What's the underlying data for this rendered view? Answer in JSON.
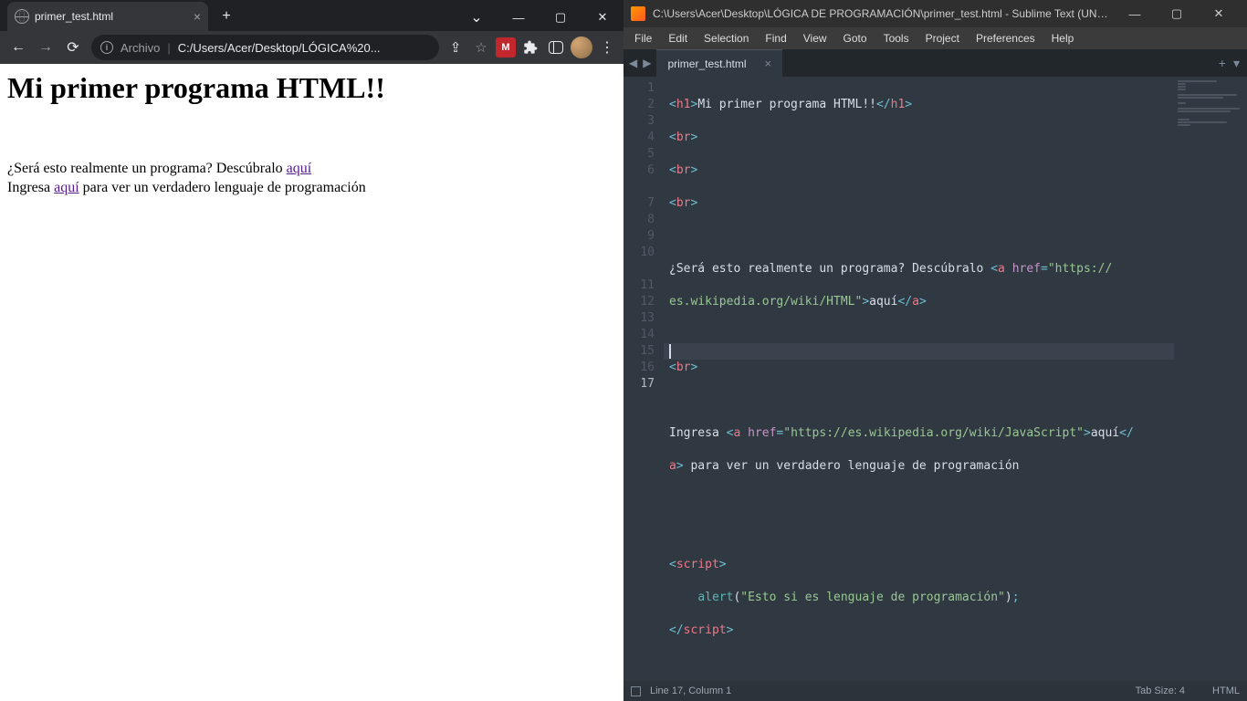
{
  "chrome": {
    "tab_title": "primer_test.html",
    "url_label": "Archivo",
    "url_path": "C:/Users/Acer/Desktop/LÓGICA%20...",
    "ext_red": "M",
    "page": {
      "h1": "Mi primer programa HTML!!",
      "line1_a": "¿Será esto realmente un programa? Descúbralo ",
      "line1_link": "aquí",
      "line2_a": "Ingresa ",
      "line2_link": "aquí",
      "line2_b": " para ver un verdadero lenguaje de programación"
    }
  },
  "sublime": {
    "title": "C:\\Users\\Acer\\Desktop\\LÓGICA DE PROGRAMACIÓN\\primer_test.html - Sublime Text (UNREGI...",
    "menu": [
      "File",
      "Edit",
      "Selection",
      "Find",
      "View",
      "Goto",
      "Tools",
      "Project",
      "Preferences",
      "Help"
    ],
    "tab": "primer_test.html",
    "lines": [
      "1",
      "2",
      "3",
      "4",
      "5",
      "6",
      "7",
      "8",
      "9",
      "10",
      "11",
      "12",
      "13",
      "14",
      "15",
      "16",
      "17"
    ],
    "code": {
      "h1_open": "h1",
      "h1_text": "Mi primer programa HTML!!",
      "h1_close": "h1",
      "br": "br",
      "l6a": "¿Será esto realmente un programa? Descúbralo ",
      "a": "a",
      "href": "href",
      "eq": "=",
      "url1": "\"https://",
      "url1b": "es.wikipedia.org/wiki/HTML\"",
      "aqui": "aquí",
      "l10a": "Ingresa ",
      "url2": "\"https://es.wikipedia.org/wiki/JavaScript\"",
      "l10b": " para ver un verdadero lenguaje de programación",
      "script": "script",
      "alert": "alert",
      "alert_str": "\"Esto si es lenguaje de programación\"",
      "semi": ";",
      "paren_o": "(",
      "paren_c": ")"
    },
    "status": {
      "pos": "Line 17, Column 1",
      "tabsize": "Tab Size: 4",
      "syntax": "HTML"
    }
  }
}
